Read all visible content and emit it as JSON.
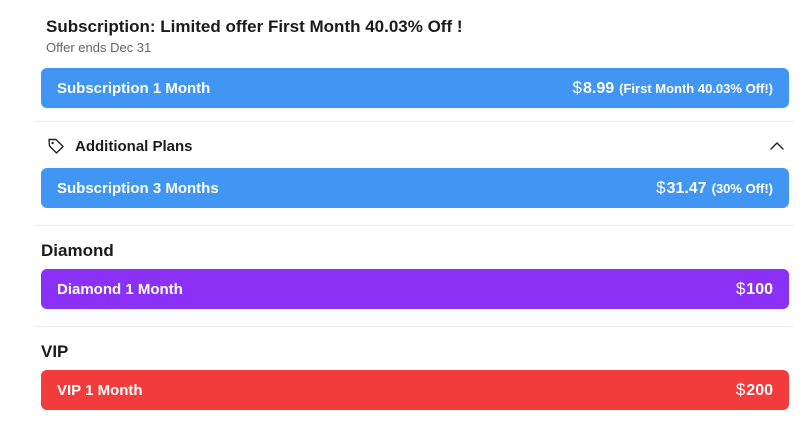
{
  "offer": {
    "title": "Subscription: Limited offer First Month 40.03% Off !",
    "subtitle": "Offer ends Dec 31"
  },
  "primary_plan": {
    "name": "Subscription 1 Month",
    "currency": "$",
    "amount": "8.99",
    "note": "(First Month 40.03% Off!)"
  },
  "additional": {
    "label": "Additional Plans",
    "icon": "tag-icon",
    "toggle_icon": "chevron-up-icon",
    "plan": {
      "name": "Subscription 3 Months",
      "currency": "$",
      "amount": "31.47",
      "note": "(30% Off!)"
    }
  },
  "diamond": {
    "title": "Diamond",
    "plan": {
      "name": "Diamond 1 Month",
      "currency": "$",
      "amount": "100"
    }
  },
  "vip": {
    "title": "VIP",
    "plan": {
      "name": "VIP 1 Month",
      "currency": "$",
      "amount": "200"
    }
  },
  "colors": {
    "subscription": "#4096f2",
    "diamond": "#8b31f5",
    "vip": "#f23b3b"
  }
}
